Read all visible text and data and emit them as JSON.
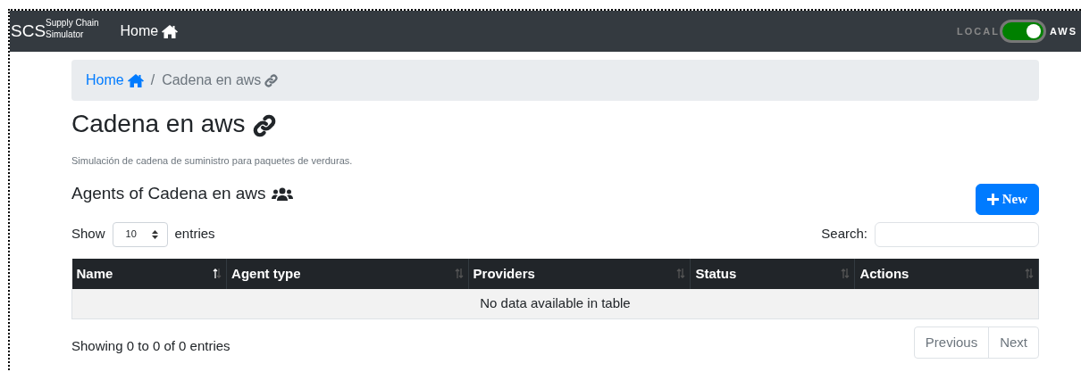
{
  "navbar": {
    "brand": "SCS",
    "brand_sub_1": "Supply Chain",
    "brand_sub_2": "Simulator",
    "home_link": "Home",
    "toggle": {
      "left_label": "LOCAL",
      "right_label": "AWS",
      "on": true
    }
  },
  "breadcrumb_separator": "/",
  "breadcrumb": [
    {
      "label": "Home",
      "kind": "link"
    },
    {
      "label": "Cadena en aws",
      "kind": "current"
    }
  ],
  "page_title": "Cadena en aws",
  "description": "Simulación de cadena de suministro para paquetes de verduras.",
  "section_title": "Agents of Cadena en aws",
  "new_button": "New",
  "length_control": {
    "before": "Show",
    "value": "10",
    "after": "entries"
  },
  "search": {
    "label": "Search:"
  },
  "table": {
    "columns": [
      {
        "label": "Name",
        "sorted": true
      },
      {
        "label": "Agent type",
        "sorted": false
      },
      {
        "label": "Providers",
        "sorted": false
      },
      {
        "label": "Status",
        "sorted": false
      },
      {
        "label": "Actions",
        "sorted": false
      }
    ],
    "empty_message": "No data available in table"
  },
  "info": "Showing 0 to 0 of 0 entries",
  "pagination": [
    {
      "label": "Previous",
      "disabled": true
    },
    {
      "label": "Next",
      "disabled": true
    }
  ]
}
